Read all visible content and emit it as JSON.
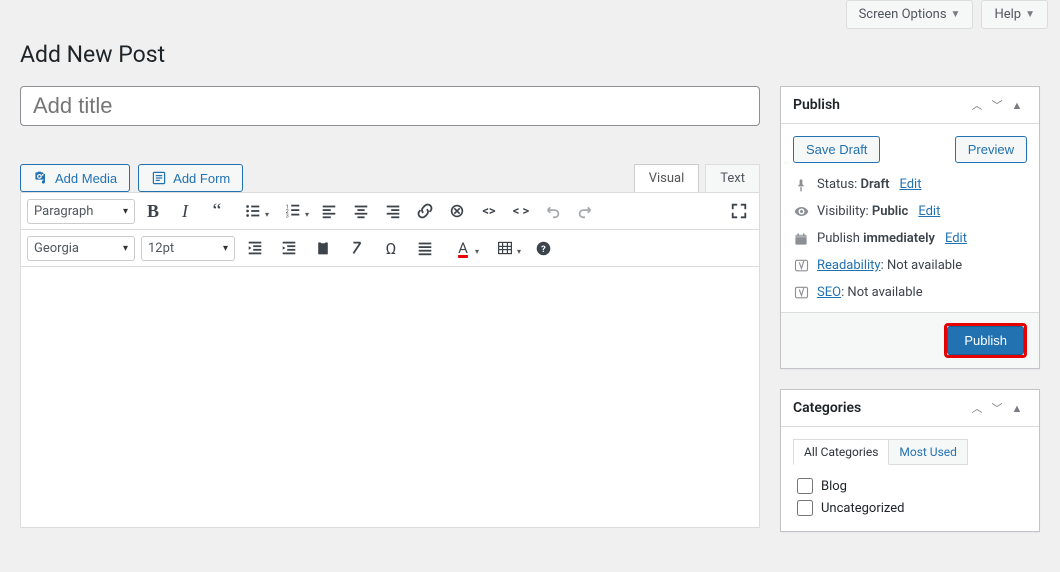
{
  "topbar": {
    "screen_options": "Screen Options",
    "help": "Help"
  },
  "heading": "Add New Post",
  "title_placeholder": "Add title",
  "media": {
    "add_media": "Add Media",
    "add_form": "Add Form"
  },
  "editor_tabs": {
    "visual": "Visual",
    "text": "Text"
  },
  "toolbar": {
    "paragraph": "Paragraph",
    "font": "Georgia",
    "fontsize": "12pt"
  },
  "publish": {
    "title": "Publish",
    "save_draft": "Save Draft",
    "preview": "Preview",
    "status_label": "Status: ",
    "status_value": "Draft",
    "visibility_label": "Visibility: ",
    "visibility_value": "Public",
    "schedule_label": "Publish ",
    "schedule_value": "immediately",
    "edit": "Edit",
    "readability_label": "Readability",
    "readability_value": ": Not available",
    "seo_label": "SEO",
    "seo_value": ": Not available",
    "publish_btn": "Publish"
  },
  "categories": {
    "title": "Categories",
    "tab_all": "All Categories",
    "tab_most": "Most Used",
    "items": [
      "Blog",
      "Uncategorized"
    ]
  }
}
